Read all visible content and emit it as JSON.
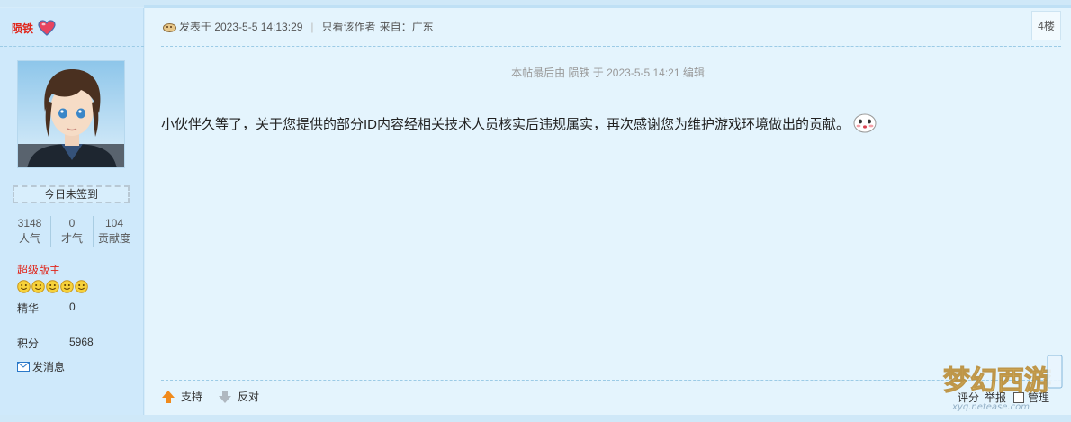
{
  "user": {
    "name": "陨铁",
    "checkin_label": "今日未签到",
    "stats": [
      {
        "value": "3148",
        "label": "人气"
      },
      {
        "value": "0",
        "label": "才气"
      },
      {
        "value": "104",
        "label": "贡献度"
      }
    ],
    "rank": "超级版主",
    "rank_stars": 5,
    "essence_label": "精华",
    "essence_value": "0",
    "points_label": "积分",
    "points_value": "5968",
    "message_label": "发消息"
  },
  "post": {
    "posted_label": "发表于 2023-5-5 14:13:29",
    "only_author_label": "只看该作者",
    "source_label": "来自：广东",
    "floor": "4楼",
    "edit_note": "本帖最后由 陨铁 于 2023-5-5 14:21 编辑",
    "content": "小伙伴久等了，关于您提供的部分ID内容经相关技术人员核实后违规属实，再次感谢您为维护游戏环境做出的贡献。"
  },
  "footer": {
    "support_label": "支持",
    "oppose_label": "反对",
    "rate_label": "评分",
    "report_label": "举报",
    "manage_label": "管理"
  },
  "watermark": {
    "text": "梦幻西游",
    "sub": "xyq.netease.com"
  },
  "colors": {
    "accent_red": "#e0261b",
    "sidebar_bg": "#cfe9fb",
    "main_bg": "#e4f4fd"
  },
  "icons": [
    "heart-icon",
    "smiley-icon",
    "mail-icon",
    "post-icon",
    "face-icon",
    "up-arrow-icon",
    "down-arrow-icon"
  ]
}
